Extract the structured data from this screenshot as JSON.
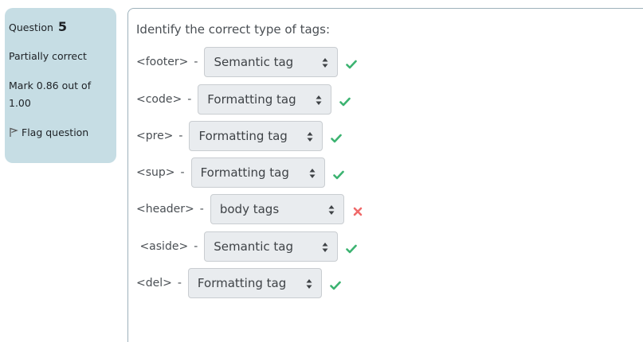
{
  "info": {
    "question_label": "Question",
    "question_number": "5",
    "state": "Partially correct",
    "grade": "Mark 0.86 out of 1.00",
    "flag_label": "Flag question"
  },
  "question": {
    "text": "Identify the correct type of tags:",
    "rows": [
      {
        "tag": "<footer>",
        "dash": "-",
        "selected": "Semantic tag",
        "result": "correct"
      },
      {
        "tag": "<code>",
        "dash": "-",
        "selected": "Formatting tag",
        "result": "correct"
      },
      {
        "tag": "<pre>",
        "dash": "-",
        "selected": "Formatting tag",
        "result": "correct"
      },
      {
        "tag": "<sup>",
        "dash": "-",
        "selected": "Formatting tag",
        "result": "correct"
      },
      {
        "tag": "<header>",
        "dash": "-",
        "selected": "body tags",
        "result": "incorrect"
      },
      {
        "tag": " <aside>",
        "dash": "-",
        "selected": "Semantic tag",
        "result": "correct"
      },
      {
        "tag": "<del>",
        "dash": "-",
        "selected": "Formatting tag",
        "result": "correct"
      }
    ]
  },
  "colors": {
    "correct": "#3cb371",
    "incorrect": "#f06a6a",
    "info_bg": "#c6dde4"
  }
}
